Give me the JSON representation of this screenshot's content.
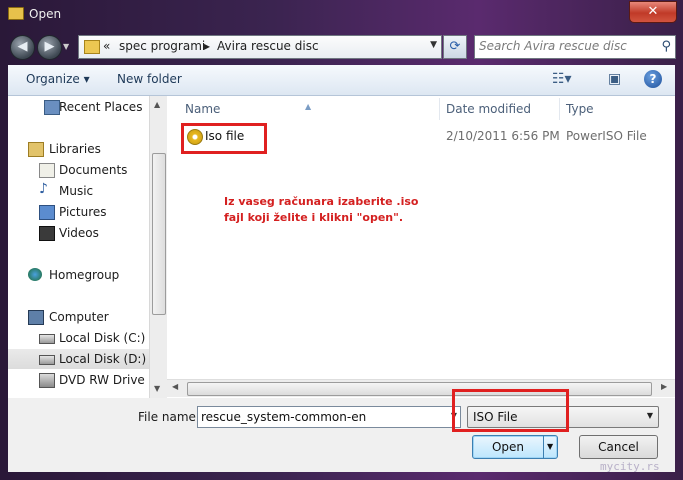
{
  "window": {
    "title": "Open",
    "close_glyph": "✕"
  },
  "nav": {
    "back_glyph": "◀",
    "forward_glyph": "▶",
    "breadcrumb": [
      "«",
      "spec programi",
      "▸",
      "Avira rescue disc"
    ],
    "refresh_glyph": "⟳",
    "search_placeholder": "Search Avira rescue disc"
  },
  "toolbar": {
    "organize_label": "Organize ▾",
    "new_folder_label": "New folder",
    "help_glyph": "?"
  },
  "sidebar": {
    "items": [
      {
        "label": "Recent Places",
        "icon": "recent-places-icon"
      },
      {
        "label": "Libraries",
        "icon": "libraries-icon"
      },
      {
        "label": "Documents",
        "icon": "documents-icon"
      },
      {
        "label": "Music",
        "icon": "music-icon"
      },
      {
        "label": "Pictures",
        "icon": "pictures-icon"
      },
      {
        "label": "Videos",
        "icon": "videos-icon"
      },
      {
        "label": "Homegroup",
        "icon": "homegroup-icon"
      },
      {
        "label": "Computer",
        "icon": "computer-icon"
      },
      {
        "label": "Local Disk (C:)",
        "icon": "hard-disk-icon"
      },
      {
        "label": "Local Disk (D:)",
        "icon": "hard-disk-icon",
        "selected": true
      },
      {
        "label": "DVD RW Drive (E:",
        "icon": "dvd-drive-icon"
      }
    ]
  },
  "files": {
    "columns": [
      "Name",
      "Date modified",
      "Type"
    ],
    "rows": [
      {
        "name": "Iso file",
        "date": "2/10/2011 6:56 PM",
        "type": "PowerISO File",
        "icon": "iso-disc-icon"
      }
    ]
  },
  "annotation": {
    "line1": "Iz vaseg računara izaberite .iso",
    "line2": "fajl koji želite i klikni \"open\"."
  },
  "bottom": {
    "file_name_label": "File name:",
    "file_name_value": "rescue_system-common-en",
    "file_type_value": "ISO File",
    "open_label": "Open",
    "cancel_label": "Cancel"
  },
  "watermark": "mycity.rs",
  "colors": {
    "annotation_red": "#e02020",
    "link_blue": "#1e3958"
  }
}
